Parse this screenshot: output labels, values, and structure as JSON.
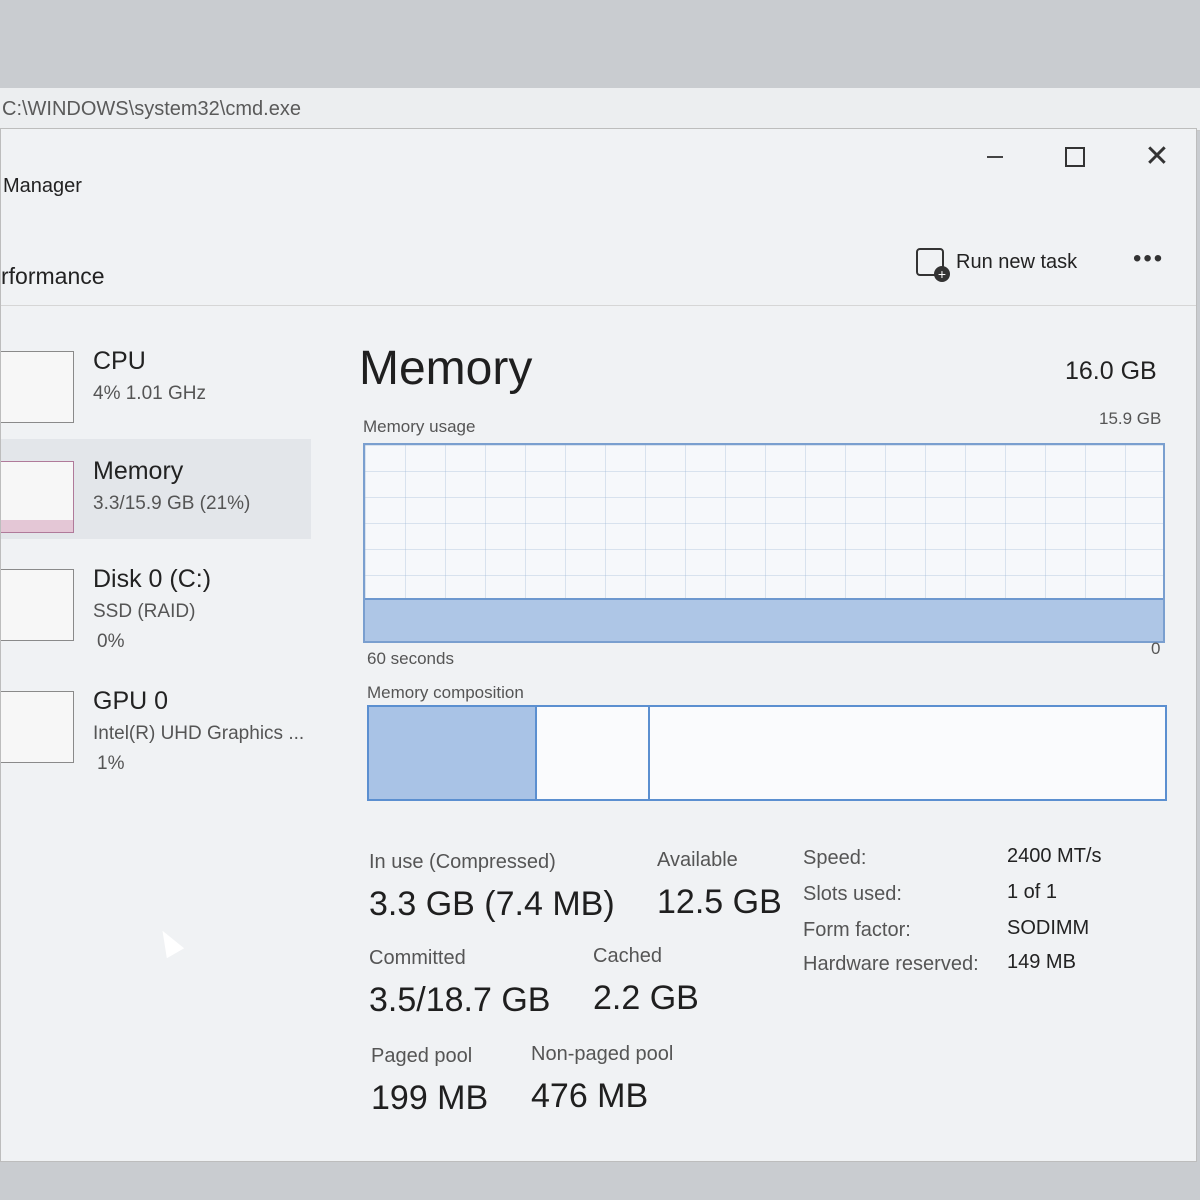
{
  "cmd_window": {
    "title": "C:\\WINDOWS\\system32\\cmd.exe"
  },
  "window": {
    "title": "Manager",
    "section": "rformance",
    "run_new_task": "Run new task",
    "more": "•••"
  },
  "sidebar": {
    "items": [
      {
        "name": "CPU",
        "sub": "4% 1.01 GHz"
      },
      {
        "name": "Memory",
        "sub": "3.3/15.9 GB (21%)"
      },
      {
        "name": "Disk 0 (C:)",
        "sub": "SSD (RAID)",
        "sub2": "0%"
      },
      {
        "name": "GPU 0",
        "sub": "Intel(R) UHD Graphics ...",
        "sub2": "1%"
      }
    ]
  },
  "main": {
    "title": "Memory",
    "total": "16.0 GB",
    "usage_label": "Memory usage",
    "usage_max": "15.9 GB",
    "usage_min": "0",
    "time_label": "60 seconds",
    "usage_level_fraction": 0.21,
    "composition_label": "Memory composition",
    "composition_fractions": {
      "in_use": 0.21,
      "modified": 0.14,
      "standby": 0.65
    }
  },
  "stats": {
    "in_use_label": "In use (Compressed)",
    "in_use_value": "3.3 GB (7.4 MB)",
    "available_label": "Available",
    "available_value": "12.5 GB",
    "committed_label": "Committed",
    "committed_value": "3.5/18.7 GB",
    "cached_label": "Cached",
    "cached_value": "2.2 GB",
    "paged_label": "Paged pool",
    "paged_value": "199 MB",
    "nonpaged_label": "Non-paged pool",
    "nonpaged_value": "476 MB"
  },
  "specs": {
    "speed_label": "Speed:",
    "speed_value": "2400 MT/s",
    "slots_label": "Slots used:",
    "slots_value": "1 of 1",
    "form_label": "Form factor:",
    "form_value": "SODIMM",
    "hw_label": "Hardware reserved:",
    "hw_value": "149 MB"
  }
}
